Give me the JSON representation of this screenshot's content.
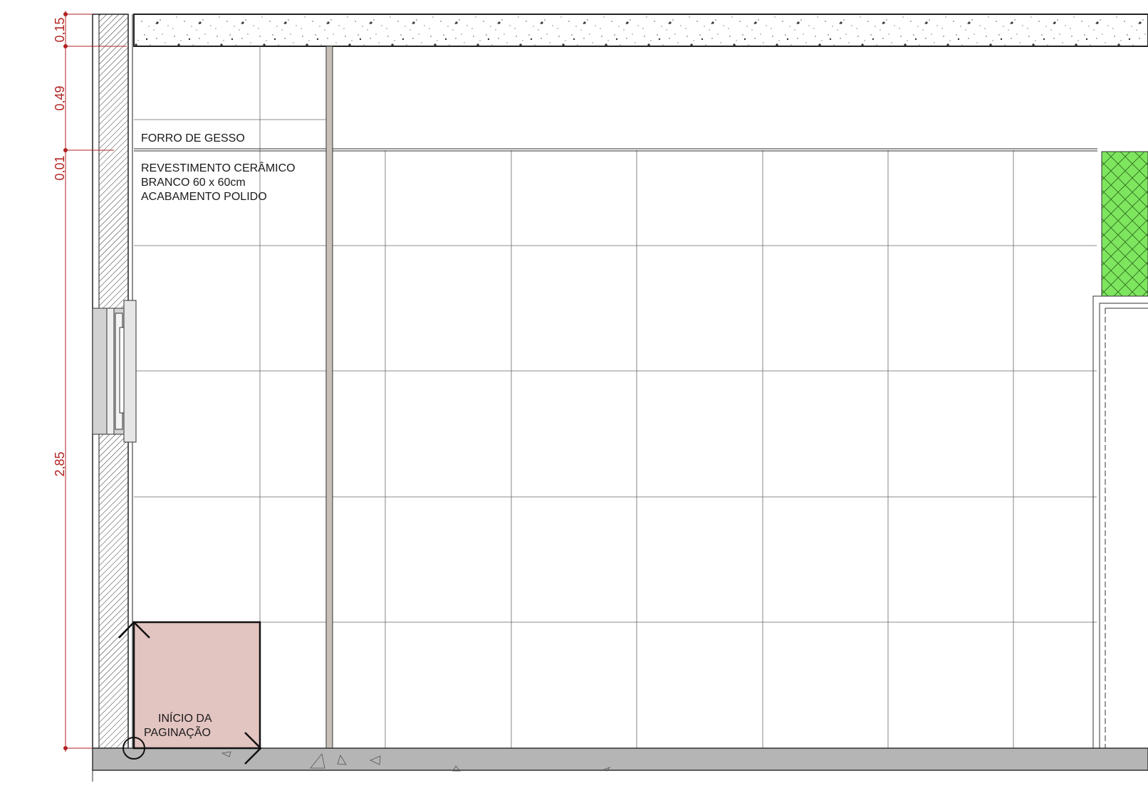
{
  "drawing": {
    "dimensions": [
      {
        "id": "slab",
        "text": "0,15"
      },
      {
        "id": "plenum",
        "text": "0,49"
      },
      {
        "id": "ceiling",
        "text": "0,01"
      },
      {
        "id": "wall",
        "text": "2,85"
      }
    ],
    "labels": {
      "ceiling": "FORRO DE GESSO",
      "finish": [
        "REVESTIMENTO CERÂMICO",
        "BRANCO 60 x  60cm",
        "ACABAMENTO POLIDO"
      ],
      "start": [
        "INÍCIO DA",
        "PAGINAÇÃO"
      ]
    },
    "colors": {
      "dimension": "#b22222",
      "start_tile": "#e2c4c1",
      "green_panel": "#7ee55f",
      "floor": "#b5b5b5"
    }
  }
}
